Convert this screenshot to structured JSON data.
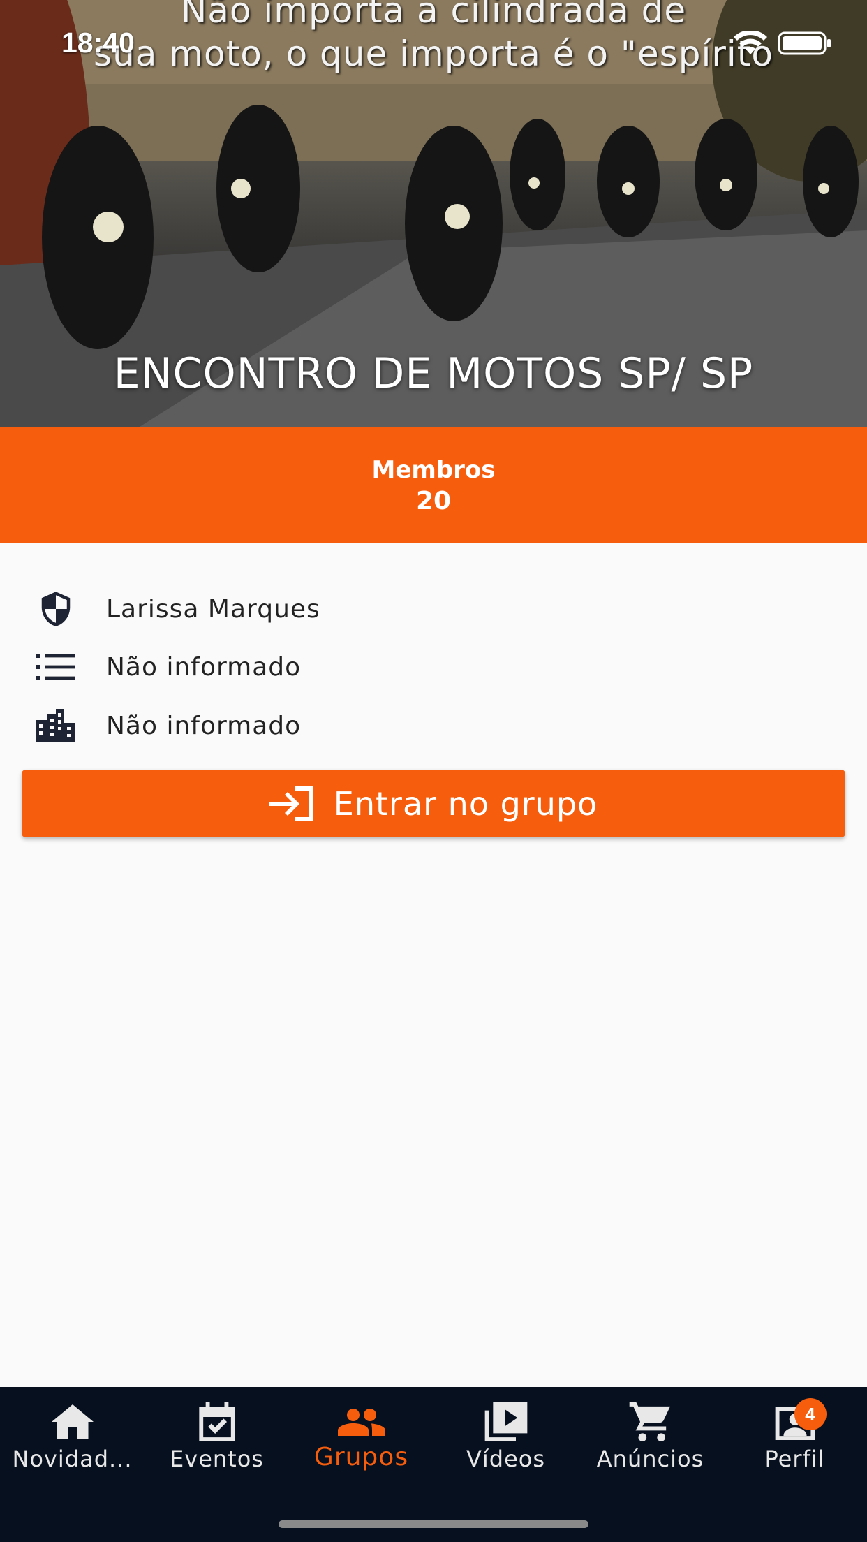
{
  "status_bar": {
    "time": "18:40"
  },
  "hero": {
    "caption_line1": "Não importa a cilindrada de",
    "caption_line2": "sua moto, o que importa é o \"espírito",
    "title": "ENCONTRO DE MOTOS SP/ SP"
  },
  "members": {
    "label": "Membros",
    "count": "20"
  },
  "info": {
    "admin": "Larissa Marques",
    "category": "Não informado",
    "city": "Não informado"
  },
  "join_button": {
    "label": "Entrar no grupo"
  },
  "nav": {
    "items": [
      {
        "label": "Novidad...",
        "icon": "home-icon"
      },
      {
        "label": "Eventos",
        "icon": "event-calendar-icon"
      },
      {
        "label": "Grupos",
        "icon": "group-icon",
        "active": true
      },
      {
        "label": "Vídeos",
        "icon": "video-library-icon"
      },
      {
        "label": "Anúncios",
        "icon": "cart-icon"
      },
      {
        "label": "Perfil",
        "icon": "profile-icon",
        "badge": "4"
      }
    ]
  },
  "colors": {
    "accent": "#f65e0e",
    "nav_bg": "#07101f",
    "background": "#fafafa"
  }
}
